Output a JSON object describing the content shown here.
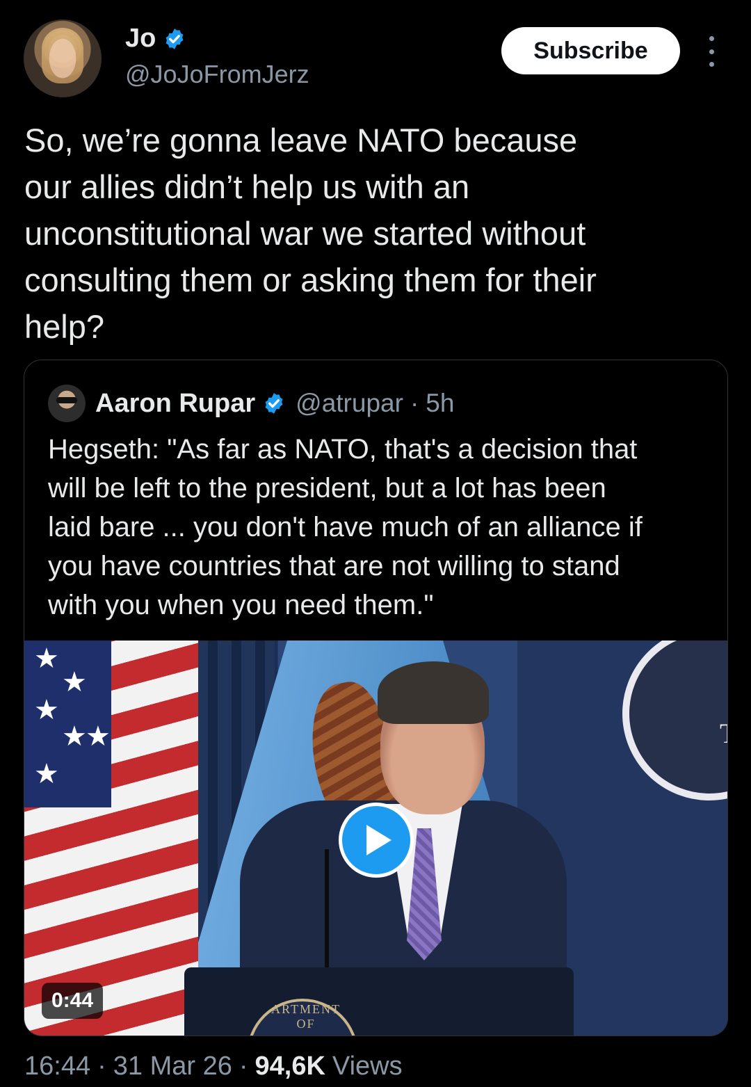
{
  "author": {
    "name": "Jo",
    "handle": "@JoJoFromJerz",
    "verified": true,
    "subscribe_label": "Subscribe"
  },
  "tweet": {
    "text_lines": [
      "So, we’re gonna leave NATO because",
      "our allies didn’t help us with an",
      "unconstitutional war we started without",
      "consulting them or asking them for their",
      "help?"
    ]
  },
  "quoted_tweet": {
    "name": "Aaron Rupar",
    "handle": "@atrupar",
    "separator": "·",
    "time": "5h",
    "text_lines": [
      "Hegseth: \"As far as NATO, that's a decision that",
      "will be left to the president, but a lot has been",
      "laid bare ... you don't have much of an alliance if",
      "you have countries that are not willing to stand",
      "with you when you need them.\""
    ],
    "video": {
      "duration": "0:44",
      "seal_text": "T",
      "podium_text": "ARTMENT OF"
    }
  },
  "meta": {
    "time": "16:44",
    "sep1": "·",
    "date": "31 Mar 26",
    "sep2": "·",
    "views_count": "94,6K",
    "views_label": "Views"
  },
  "colors": {
    "background": "#000000",
    "text": "#e7e9ea",
    "secondary": "#8b98a5",
    "accent": "#1d9bf0"
  },
  "icons": {
    "verified": "verified-badge-icon",
    "more": "more-vertical-icon",
    "play": "play-icon"
  }
}
